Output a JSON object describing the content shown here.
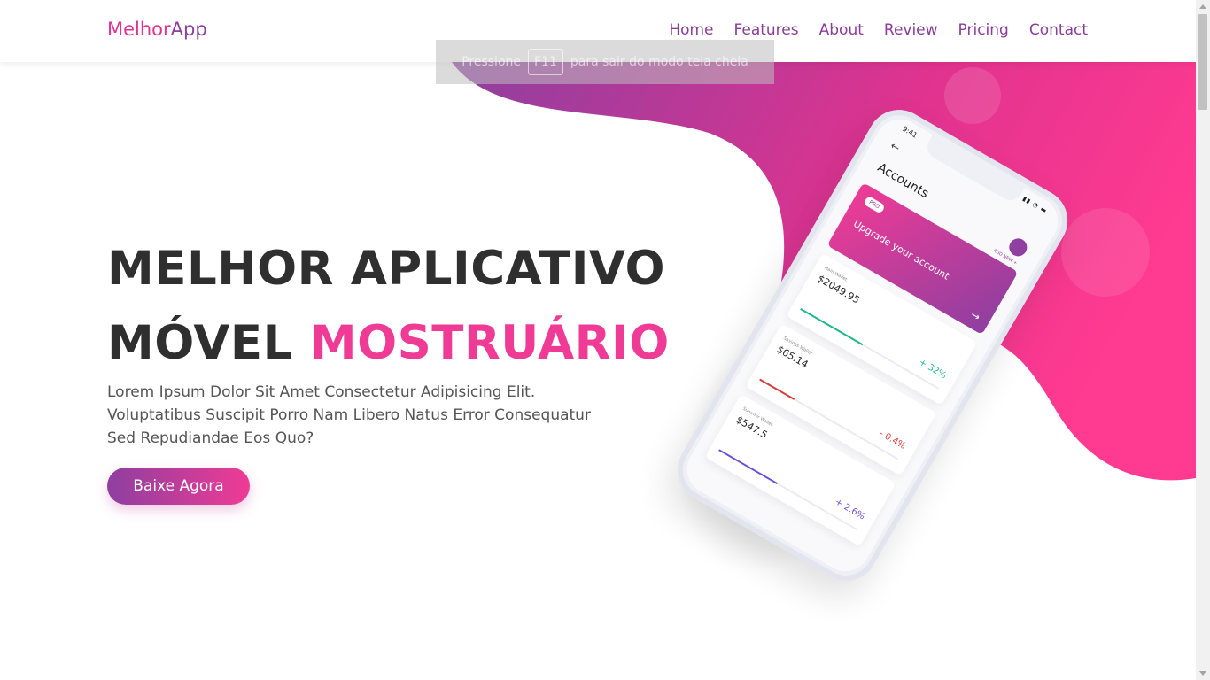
{
  "brand": {
    "part1": "Melhor",
    "part2": "App"
  },
  "nav": [
    "Home",
    "Features",
    "About",
    "Review",
    "Pricing",
    "Contact"
  ],
  "toast": {
    "before": "Pressione",
    "key": "F11",
    "after": "para sair do modo tela cheia"
  },
  "hero": {
    "line1": "MELHOR APLICATIVO",
    "line2_dark": "MÓVEL",
    "line2_pink": "MOSTRUÁRIO",
    "description": "Lorem Ipsum Dolor Sit Amet Consectetur Adipisicing Elit. Voluptatibus Suscipit Porro Nam Libero Natus Error Consequatur Sed Repudiandae Eos Quo?",
    "cta": "Baixe Agora"
  },
  "phone": {
    "time": "9:41",
    "back": "←",
    "title": "Accounts",
    "upgrade": {
      "badge": "PRO",
      "add_new": "ADD NEW +",
      "text": "Upgrade your account",
      "arrow": "→"
    },
    "wallets": [
      {
        "name": "Main Wallet",
        "amount": "$2049.95",
        "change": "+ 32%",
        "color": "#1fb88a",
        "progress": 0.45
      },
      {
        "name": "Savings Wallet",
        "amount": "$65.14",
        "change": "- 0.4%",
        "color": "#d93a3a",
        "progress": 0.25
      },
      {
        "name": "Summer Wallet",
        "amount": "$547.5",
        "change": "+ 2.6%",
        "color": "#6a4fdb",
        "progress": 0.42
      }
    ]
  },
  "colors": {
    "pink": "#ef3b95",
    "purple": "#8e3fa0"
  }
}
